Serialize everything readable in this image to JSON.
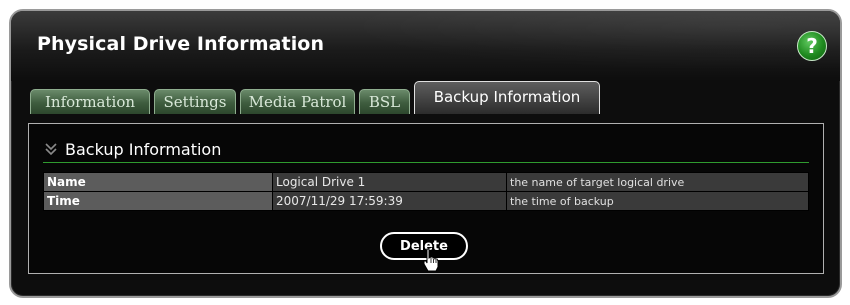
{
  "panel": {
    "title": "Physical Drive Information",
    "help_label": "?"
  },
  "tabs": [
    {
      "label": "Information",
      "active": false
    },
    {
      "label": "Settings",
      "active": false
    },
    {
      "label": "Media Patrol",
      "active": false
    },
    {
      "label": "BSL",
      "active": false
    },
    {
      "label": "Backup Information",
      "active": true
    }
  ],
  "section": {
    "title": "Backup Information",
    "icon": "double-chevron-down-icon"
  },
  "table": {
    "rows": [
      {
        "key": "Name",
        "value": "Logical Drive 1",
        "description": "the name of target logical drive"
      },
      {
        "key": "Time",
        "value": "2007/11/29 17:59:39",
        "description": "the time of backup"
      }
    ]
  },
  "actions": {
    "delete_label": "Delete"
  },
  "colors": {
    "accent_green": "#2f9b2f",
    "tab_green": "#3e5c3e",
    "help_green": "#1f8a1f"
  }
}
